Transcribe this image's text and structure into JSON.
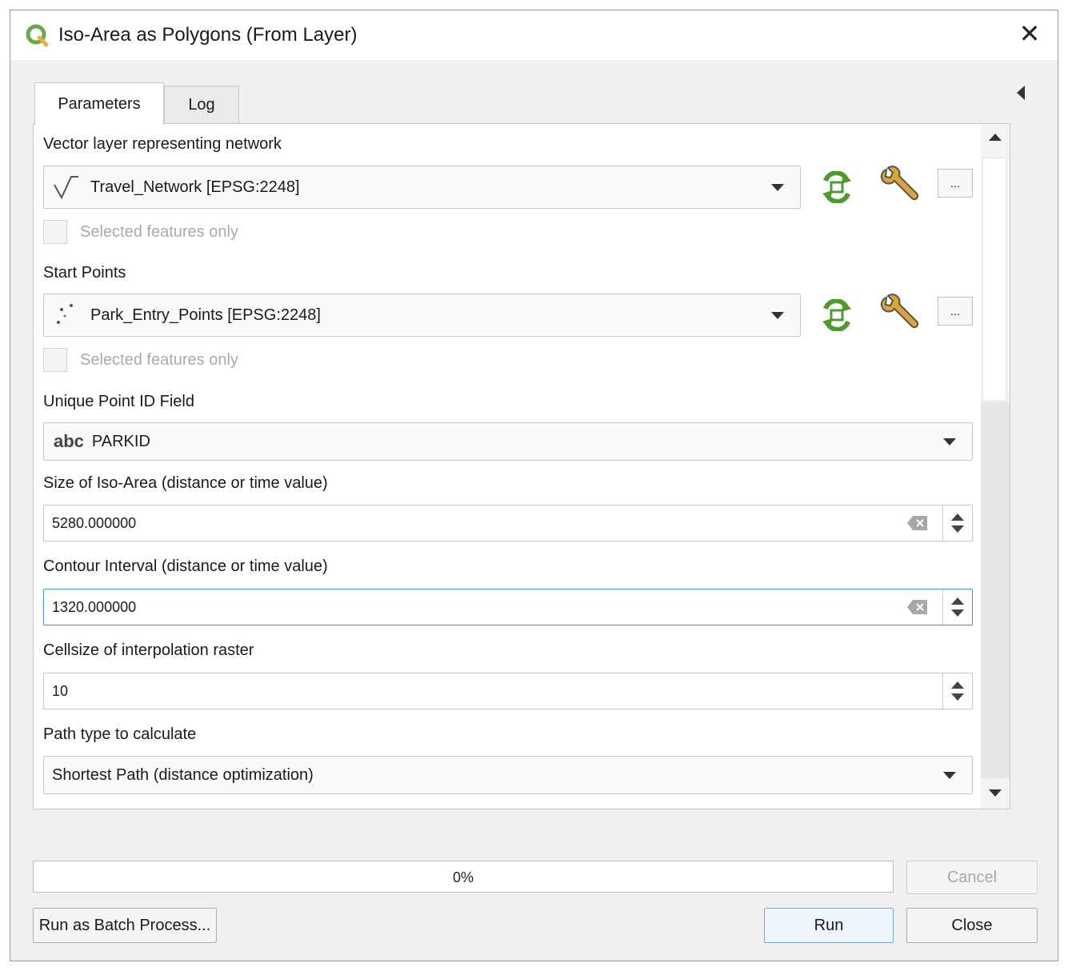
{
  "window": {
    "title": "Iso-Area as Polygons (From Layer)",
    "close_glyph": "✕"
  },
  "tabs": [
    {
      "label": "Parameters",
      "active": true
    },
    {
      "label": "Log",
      "active": false
    }
  ],
  "params": {
    "network": {
      "label": "Vector layer representing network",
      "value": "Travel_Network [EPSG:2248]",
      "icon": "line-layer-icon",
      "selected_only_label": "Selected features only",
      "more_label": "..."
    },
    "start_points": {
      "label": "Start Points",
      "value": "Park_Entry_Points [EPSG:2248]",
      "icon": "point-layer-icon",
      "selected_only_label": "Selected features only",
      "more_label": "..."
    },
    "id_field": {
      "label": "Unique Point ID Field",
      "type_prefix": "abc",
      "value": "PARKID"
    },
    "iso_size": {
      "label": "Size of Iso-Area (distance or time value)",
      "value": "5280.000000"
    },
    "contour_interval": {
      "label": "Contour Interval (distance or time value)",
      "value": "1320.000000"
    },
    "cellsize": {
      "label": "Cellsize of interpolation raster",
      "value": "10"
    },
    "path_type": {
      "label": "Path type to calculate",
      "value": "Shortest Path (distance optimization)"
    }
  },
  "progress": {
    "percent": 0,
    "text": "0%"
  },
  "buttons": {
    "cancel": "Cancel",
    "batch": "Run as Batch Process...",
    "run": "Run",
    "close": "Close"
  },
  "colors": {
    "accent_green": "#4e9a2f",
    "focus_blue": "#4a8fd6",
    "qgis_green": "#6aa84f"
  }
}
